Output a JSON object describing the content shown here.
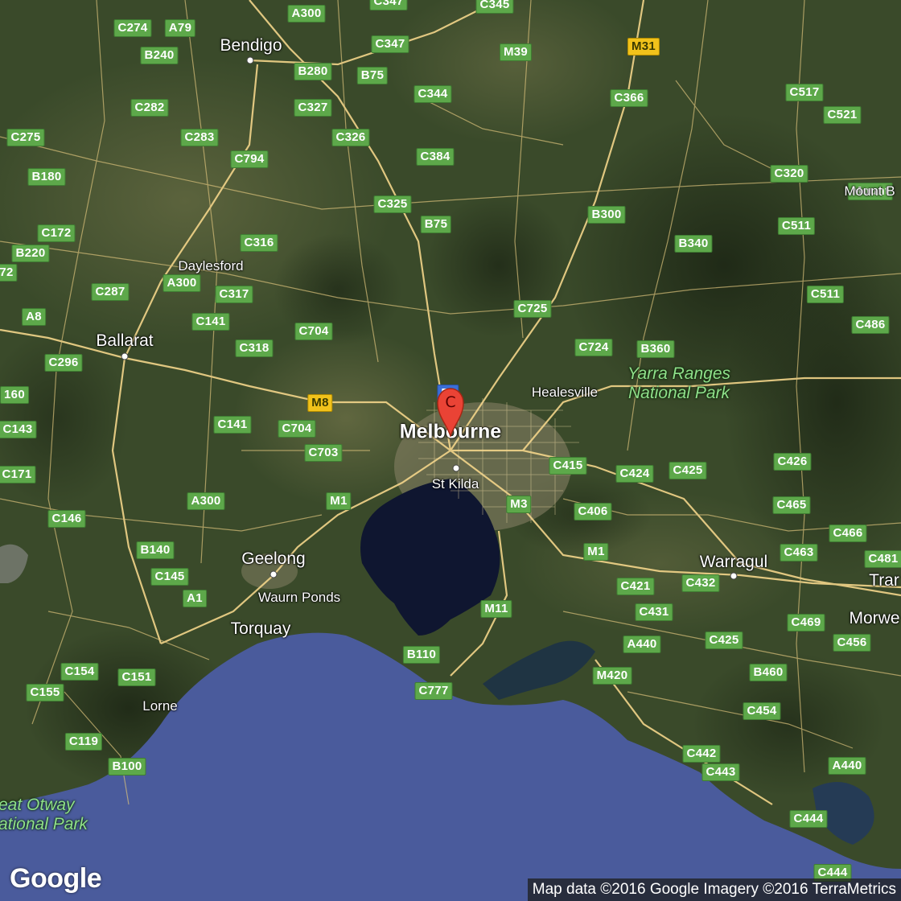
{
  "map": {
    "colors": {
      "land_dark": "#2c3a20",
      "land_mid": "#3e4d2d",
      "land_light": "#56603b",
      "forest": "#24301a",
      "bay": "#0f1630",
      "ocean": "#4a5b9c",
      "road_major": "#f3d58a",
      "road_minor": "#d9c07a",
      "city": "#c9b88e",
      "shield_green": "#5da84a",
      "shield_yellow": "#f1c21b"
    },
    "places": [
      {
        "id": "bendigo",
        "name": "Bendigo"
      },
      {
        "id": "daylesford",
        "name": "Daylesford"
      },
      {
        "id": "ballarat",
        "name": "Ballarat"
      },
      {
        "id": "melbourne",
        "name": "Melbourne"
      },
      {
        "id": "st-kilda",
        "name": "St Kilda"
      },
      {
        "id": "healesville",
        "name": "Healesville"
      },
      {
        "id": "geelong",
        "name": "Geelong"
      },
      {
        "id": "waurn-ponds",
        "name": "Waurn Ponds"
      },
      {
        "id": "torquay",
        "name": "Torquay"
      },
      {
        "id": "lorne",
        "name": "Lorne"
      },
      {
        "id": "warragul",
        "name": "Warragul"
      },
      {
        "id": "mount-b",
        "name": "Mount B"
      },
      {
        "id": "traralgon",
        "name": "Trar"
      },
      {
        "id": "morwell",
        "name": "Morwe"
      }
    ],
    "parks": [
      {
        "id": "yarra-ranges",
        "lines": [
          "Yarra Ranges",
          "National Park"
        ]
      },
      {
        "id": "great-otway",
        "lines": [
          "eat Otway",
          "ational Park"
        ]
      }
    ],
    "route_shields": [
      "C274",
      "A79",
      "A300",
      "C347",
      "C345",
      "B240",
      "C347",
      "M39",
      "M31",
      "B280",
      "B75",
      "C282",
      "C327",
      "C344",
      "C366",
      "C517",
      "C521",
      "C275",
      "C283",
      "C326",
      "C794",
      "C384",
      "C320",
      "B180",
      "C325",
      "B300",
      "Mount",
      "C172",
      "C316",
      "B75",
      "C511",
      "B340",
      "B220",
      "72",
      "A300",
      "C287",
      "C317",
      "C511",
      "C725",
      "A8",
      "C141",
      "C704",
      "C486",
      "C318",
      "C724",
      "B360",
      "C296",
      "M8",
      "160",
      "C141",
      "C704",
      "C143",
      "C703",
      "C415",
      "C424",
      "C425",
      "C426",
      "C171",
      "A300",
      "M1",
      "M3",
      "C406",
      "C465",
      "C146",
      "C466",
      "B140",
      "M1",
      "C463",
      "C481",
      "C145",
      "C421",
      "C432",
      "A1",
      "M11",
      "C431",
      "C469",
      "C456",
      "A440",
      "C425",
      "C154",
      "C151",
      "B110",
      "M420",
      "B460",
      "C155",
      "C777",
      "C454",
      "C119",
      "C442",
      "B100",
      "C443",
      "A440",
      "C444",
      "C444",
      "55"
    ],
    "marker": {
      "label": "C"
    }
  },
  "branding": {
    "logo": "Google"
  },
  "attribution": "Map data ©2016 Google  Imagery ©2016 TerraMetrics"
}
